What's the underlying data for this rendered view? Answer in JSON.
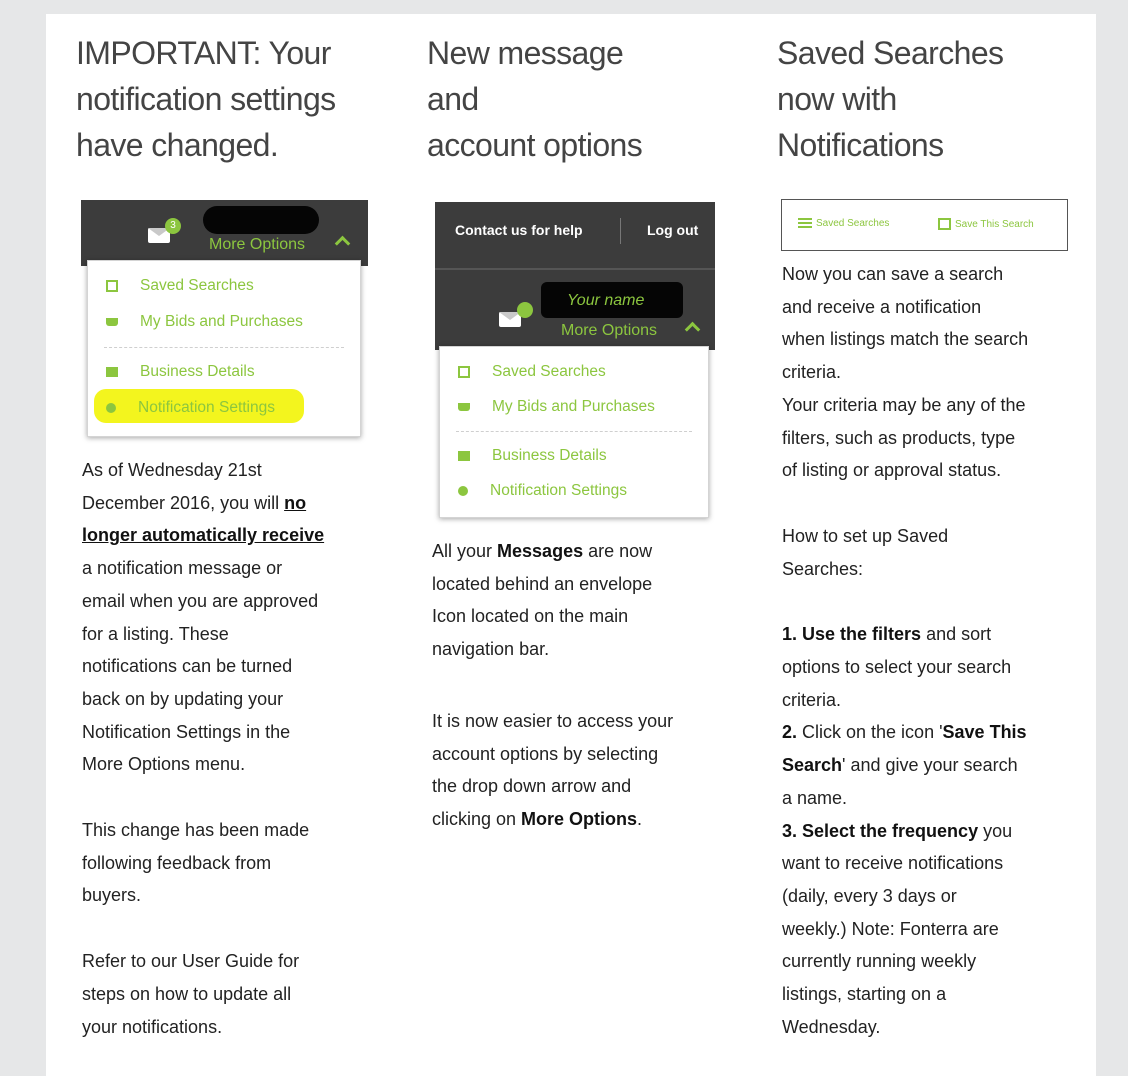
{
  "col1": {
    "heading": [
      "IMPORTANT: Your",
      "notification settings",
      "have changed."
    ],
    "shot": {
      "badge": "3",
      "more_options": "More Options",
      "menu": [
        "Saved Searches",
        "My Bids and Purchases",
        "Business Details",
        "Notification Settings"
      ]
    },
    "para1": {
      "l1": "As of Wednesday 21st",
      "l2a": "December 2016, you will ",
      "l2b": "no",
      "l3": "longer automatically receive",
      "rest": [
        "a notification message or",
        "email when you are approved",
        "for a listing. These",
        "notifications can be turned",
        "back on by updating your",
        "Notification Settings in the",
        "More Options menu."
      ]
    },
    "para2": [
      "This change has been made",
      "following feedback from",
      "buyers."
    ],
    "para3": [
      "Refer to our User Guide for",
      "steps on how to update all",
      "your notifications."
    ]
  },
  "col2": {
    "heading": [
      "New message",
      "and",
      "account options"
    ],
    "shot": {
      "contact": "Contact us for help",
      "logout": "Log out",
      "your_name": "Your name",
      "more_options": "More Options",
      "menu": [
        "Saved Searches",
        "My Bids and Purchases",
        "Business Details",
        "Notification Settings"
      ]
    },
    "para1": {
      "a": "All your ",
      "b": "Messages",
      "c": " are now",
      "rest": [
        "located behind an envelope",
        "Icon located on the main",
        "navigation bar."
      ]
    },
    "para2": {
      "lines": [
        "It is now easier to access your",
        "account options by selecting",
        "the drop down arrow and"
      ],
      "last_a": "clicking on ",
      "last_b": "More Options",
      "last_c": "."
    }
  },
  "col3": {
    "heading": [
      "Saved Searches",
      "now with",
      "Notifications"
    ],
    "toolbar": {
      "saved": "Saved Searches",
      "save_this": "Save This Search"
    },
    "para1": [
      "Now you can save a search",
      "and receive a notification",
      "when listings match the search",
      "criteria.",
      "Your criteria may be any of the",
      "filters, such as products, type",
      "of listing or approval status."
    ],
    "para2": [
      "How to set up Saved",
      "Searches:"
    ],
    "step1": {
      "a": "1. Use the filters",
      "b": " and sort",
      "rest": [
        "options to select your search",
        "criteria."
      ]
    },
    "step2": {
      "a": "2.",
      "b": " Click on the icon '",
      "c": "Save This",
      "d": "Search",
      "e": "' and give your search",
      "rest": [
        "a name."
      ]
    },
    "step3": {
      "a": "3. Select the frequency",
      "b": " you",
      "rest": [
        "want to receive notifications",
        "(daily, every 3 days or",
        "weekly.) Note: Fonterra are",
        "currently running weekly",
        "listings, starting on a",
        "Wednesday."
      ]
    }
  },
  "colors": {
    "accent_green": "#8cc63f",
    "nav_dark": "#3c3c3c",
    "highlight": "#f3f51e"
  }
}
